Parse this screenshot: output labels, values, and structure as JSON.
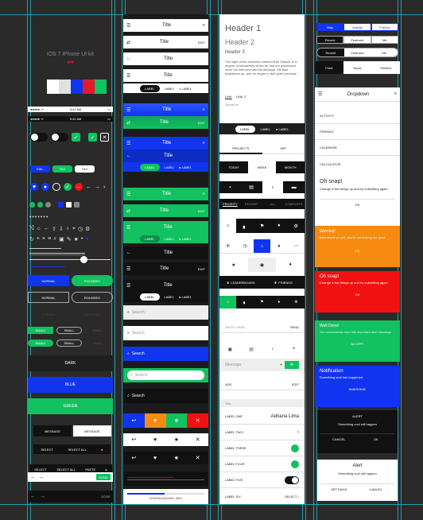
{
  "col1": {
    "kit_title": "iOS 7 iPhone UI kit",
    "kit_sub": "###",
    "swatches": [
      "#ffffff",
      "#e0e0e0",
      "#1034f0",
      "#e11b2a",
      "#12c160"
    ],
    "status_time": "9:41 AM",
    "seg_fail": "FAIL",
    "seg_tag": "TAG",
    "btn_normal": "NORMAL",
    "btn_rounded": "ROUNDED",
    "btn_small": "SMALL",
    "bar_dark": "DARK",
    "bar_blue": "BLUE",
    "bar_green": "GREEN",
    "message": "MESSAGE",
    "select": "SELECT",
    "select_all": "SELECT ALL",
    "paste": "PASTE",
    "done": "DONE"
  },
  "col2": {
    "title": "Title",
    "edit": "EDIT",
    "label": "LABEL",
    "search": "Search",
    "downloading": "DOWNLOADING: 48%",
    "progress": 0.48
  },
  "col3": {
    "h1": "Header 1",
    "h2": "Header 2",
    "h3": "Header 3",
    "body": "The sight of the tumblers restored Bob Sawyer to a degree of equanimity which he had not possessed since his interview with his landlady. His face brightened up, and he began to feel quite convivial.",
    "link1": "LINK",
    "link2": "LINK 2",
    "signature": "Signature",
    "label": "LABEL",
    "tab_projects": "PROJECTS",
    "tab_wip": "WIP",
    "seg_today": "TODAY",
    "seg_week": "WEEK",
    "seg_month": "MONTH",
    "filter_priority": "PRIORITY",
    "filter_recent": "RECENT",
    "filter_all": "ALL",
    "filter_complete": "COMPLETE",
    "leaderboard": "LEADERBOARD",
    "friends": "FRIENDS",
    "write_here": "WRITE HERE",
    "send": "SEND",
    "message": "Message",
    "add": "ADD",
    "edit": "EDIT",
    "section": "Title",
    "list_labels": [
      "LABEL ONE",
      "LABEL TWO",
      "LABEL THREE",
      "LABEL FOUR",
      "LABEL FIVE",
      "LABEL SIX"
    ],
    "list_value_one": "Adriana Lima",
    "list_value_six": "SELECT"
  },
  "col4": {
    "tabs1": [
      "Map",
      "Activity",
      "Friends"
    ],
    "tabs2": [
      "Recent",
      "Featured",
      "Me"
    ],
    "tabs3": [
      "Recent",
      "Featured",
      "Me"
    ],
    "tabs4": [
      "Feed",
      "News",
      "Timeline"
    ],
    "dropdown": "Dropdown",
    "menu": [
      "ACTIVITY",
      "FRIENDS",
      "CALENDAR",
      "CALCULATOR"
    ],
    "alert1_title": "Oh snap!",
    "alert1_body": "Change a few things up and try submitting again.",
    "ok": "OK",
    "warning_title": "Warning!",
    "warning_body": "Best check yo self, you're not looking too good.",
    "alert2_title": "Oh snap!",
    "alert2_body": "Change a few things up and try submitting again.",
    "done_title": "Well Done!",
    "done_body": "You successfully read this important alert message.",
    "accept": "ACCEPT",
    "notif_title": "Notification",
    "notif_body": "Something cool has happened.",
    "awesome": "AWESOME!",
    "alert_small": "ALERT",
    "alert_msg": "Something cool will happen",
    "cancel": "CANCEL",
    "alert_big": "Alert",
    "settings": "SETTINGS"
  }
}
